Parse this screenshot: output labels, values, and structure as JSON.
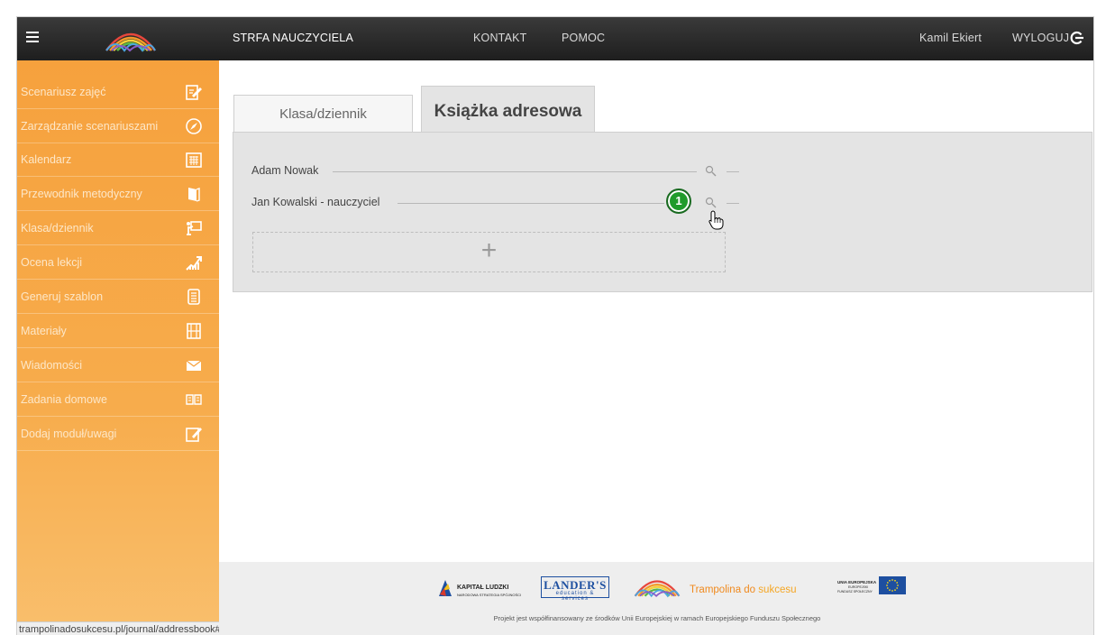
{
  "topbar": {
    "zone_label": "STRFA NAUCZYCIELA",
    "contact_label": "KONTAKT",
    "help_label": "POMOC",
    "user_name": "Kamil Ekiert",
    "logout_label": "WYLOGUJ"
  },
  "sidebar": {
    "items": [
      {
        "label": "Scenariusz zajęć",
        "icon": "pencil-note-icon"
      },
      {
        "label": "Zarządzanie scenariuszami",
        "icon": "compass-icon"
      },
      {
        "label": "Kalendarz",
        "icon": "calendar-icon"
      },
      {
        "label": "Przewodnik metodyczny",
        "icon": "book-icon"
      },
      {
        "label": "Klasa/dziennik",
        "icon": "whiteboard-icon"
      },
      {
        "label": "Ocena lekcji",
        "icon": "chart-up-icon"
      },
      {
        "label": "Generuj szablon",
        "icon": "template-icon"
      },
      {
        "label": "Materiały",
        "icon": "film-icon"
      },
      {
        "label": "Wiadomości",
        "icon": "envelope-icon"
      },
      {
        "label": "Zadania domowe",
        "icon": "open-book-icon"
      },
      {
        "label": "Dodaj moduł/uwagi",
        "icon": "edit-note-icon"
      }
    ]
  },
  "tabs": [
    {
      "label": "Klasa/dziennik",
      "active": false
    },
    {
      "label": "Książka adresowa",
      "active": true
    }
  ],
  "contacts": [
    {
      "name": "Adam Nowak",
      "badge": null
    },
    {
      "name": "Jan Kowalski - nauczyciel",
      "badge": "1"
    }
  ],
  "add_button_symbol": "+",
  "status_url": "trampolinadosukcesu.pl/journal/addressbook#",
  "footer": {
    "kapital_title": "KAPITAŁ LUDZKI",
    "kapital_sub": "NARODOWA STRATEGIA SPÓJNOŚCI",
    "landers_title": "LANDER'S",
    "landers_sub": "education & services",
    "trampolina_part1": "Trampolina do",
    "trampolina_part2": "sukcesu",
    "eu_title": "UNIA EUROPEJSKA",
    "eu_sub1": "EUROPEJSKI",
    "eu_sub2": "FUNDUSZ SPOŁECZNY",
    "note": "Projekt jest współfinansowany ze środków Unii Europejskiej w ramach Europejskiego Funduszu Społecznego"
  },
  "colors": {
    "sidebar_orange": "#f6a13d",
    "topbar_dark": "#2a2a2a",
    "badge_green": "#1f9b2a",
    "panel_gray": "#e4e4e4"
  }
}
